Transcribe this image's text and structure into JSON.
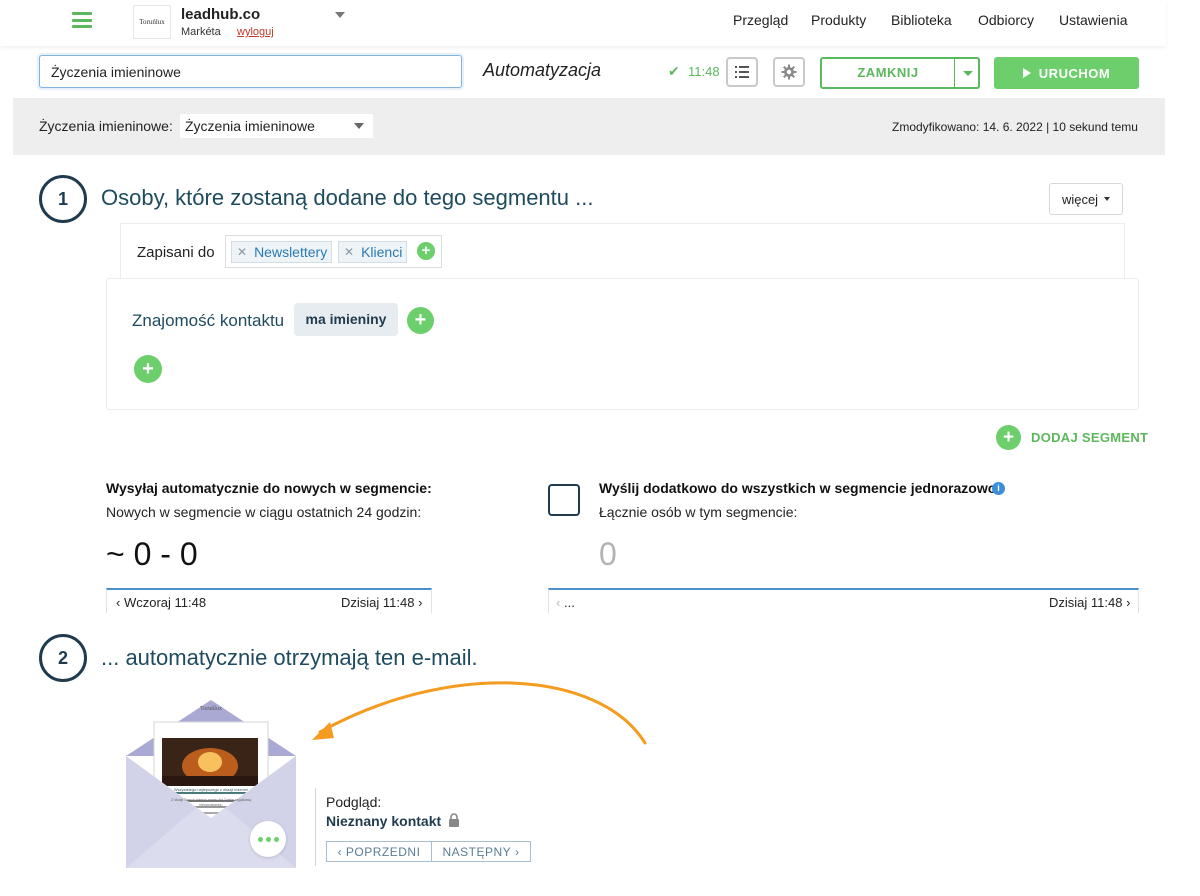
{
  "header": {
    "logo_text": "Toruńlux",
    "account_name": "leadhub.co",
    "user_name": "Markéta",
    "logout_label": "wyloguj",
    "nav": [
      "Przegląd",
      "Produkty",
      "Biblioteka",
      "Odbiorcy",
      "Ustawienia"
    ]
  },
  "toolbar": {
    "name_value": "Życzenia imieninowe",
    "section_title": "Automatyzacja",
    "saved_time": "11:48",
    "close_label": "ZAMKNIJ",
    "run_label": "URUCHOM"
  },
  "subheader": {
    "label": "Życzenia imieninowe:",
    "selected": "Życzenia imieninowe",
    "modified": "Zmodyfikowano: 14. 6. 2022 | 10 sekund temu"
  },
  "step1": {
    "number": "1",
    "title": "Osoby, które zostaną dodane do tego segmentu ...",
    "more_label": "więcej",
    "subscribed_label": "Zapisani do",
    "tags": [
      "Newslettery",
      "Klienci"
    ],
    "knowledge_label": "Znajomość kontaktu",
    "knowledge_chip": "ma imieniny",
    "add_segment_label": "DODAJ SEGMENT"
  },
  "sending": {
    "auto_title": "Wysyłaj automatycznie do nowych w segmencie:",
    "auto_sub": "Nowych w segmencie w ciągu ostatnich 24 godzin:",
    "auto_count": "~ 0 - 0",
    "auto_from": "Wczoraj 11:48",
    "auto_to": "Dzisiaj 11:48",
    "once_title": "Wyślij dodatkowo do wszystkich w segmencie jednorazowo:",
    "once_sub": "Łącznie osób w tym segmencie:",
    "once_count": "0",
    "once_from": "...",
    "once_to": "Dzisiaj 11:48",
    "once_checked": false
  },
  "step2": {
    "number": "2",
    "title": "... automatycznie otrzymają ten e-mail.",
    "preview_label": "Podgląd:",
    "preview_contact": "Nieznany kontakt",
    "prev_label": "POPRZEDNI",
    "next_label": "NASTĘPNY",
    "email_thumb": {
      "brand": "Toruńlux",
      "headline": "Wszystkiego najlepszego z okazji imienin!",
      "body": "Z okazji Twoich imienin mamy dla Ciebie wyjątkową niespodziankę."
    }
  },
  "colors": {
    "accent_green": "#6ccf6c",
    "navy": "#1f3b4d",
    "link_blue": "#2a7ab0",
    "arrow_orange": "#f39c1f",
    "envelope": "#dcdcef"
  }
}
